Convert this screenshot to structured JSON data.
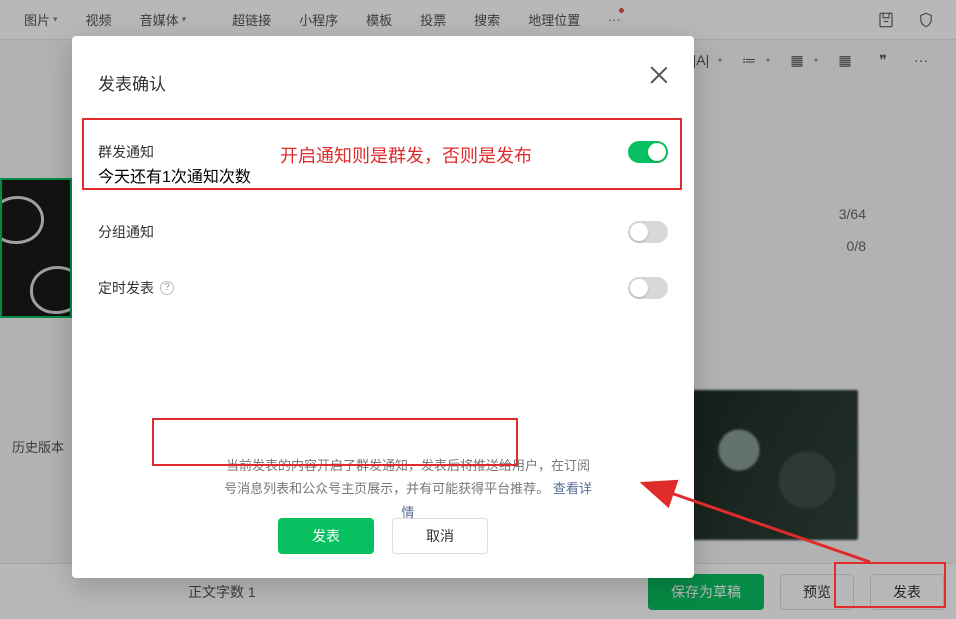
{
  "toolbar": {
    "tabs": [
      "图片",
      "视频",
      "音媒体",
      "超链接",
      "小程序",
      "模板",
      "投票",
      "搜索",
      "地理位置"
    ],
    "more": "···"
  },
  "thumb": {
    "history_label": "历史版本"
  },
  "counters": {
    "line1": "3/64",
    "line2": "0/8"
  },
  "bottom": {
    "word_count": "正文字数  1",
    "save_draft": "保存为草稿",
    "preview": "预览",
    "publish": "发表"
  },
  "modal": {
    "title": "发表确认",
    "opt1": {
      "label": "群发通知",
      "sub": "今天还有1次通知次数"
    },
    "opt2": {
      "label": "分组通知"
    },
    "opt3": {
      "label": "定时发表"
    },
    "info_seg1": "当前发表的内容开启了群发通知，发表后将推送给用户",
    "info_seg2": "，在订阅号消息列表和公众号主页展示，并有可能获得平台推荐。",
    "info_link": "查看详情",
    "publish_btn": "发表",
    "cancel_btn": "取消"
  },
  "annotation": {
    "hint": "开启通知则是群发，否则是发布"
  }
}
